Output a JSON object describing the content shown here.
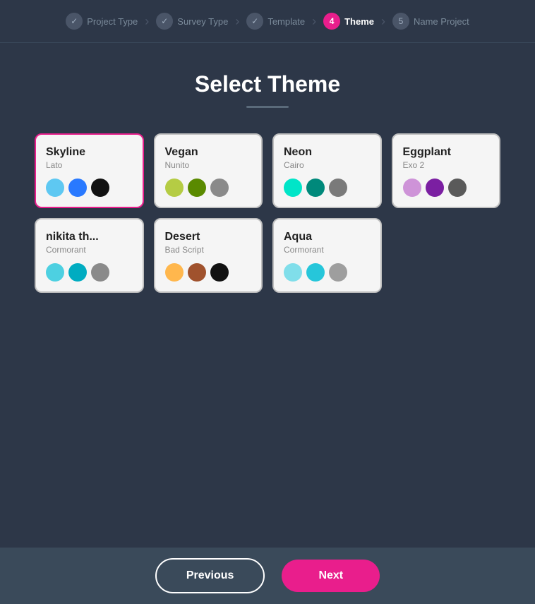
{
  "stepper": {
    "steps": [
      {
        "id": "project-type",
        "label": "Project Type",
        "state": "checked",
        "number": "✓"
      },
      {
        "id": "survey-type",
        "label": "Survey Type",
        "state": "checked",
        "number": "✓"
      },
      {
        "id": "template",
        "label": "Template",
        "state": "checked",
        "number": "✓"
      },
      {
        "id": "theme",
        "label": "Theme",
        "state": "active",
        "number": "4"
      },
      {
        "id": "name-project",
        "label": "Name Project",
        "state": "inactive",
        "number": "5"
      }
    ]
  },
  "page": {
    "title": "Select Theme",
    "themes": [
      {
        "id": "skyline",
        "name": "Skyline",
        "font": "Lato",
        "selected": true,
        "colors": [
          "#5ec8f2",
          "#2979ff",
          "#111111"
        ]
      },
      {
        "id": "vegan",
        "name": "Vegan",
        "font": "Nunito",
        "selected": false,
        "colors": [
          "#b5cc44",
          "#5a8a00",
          "#8a8a8a"
        ]
      },
      {
        "id": "neon",
        "name": "Neon",
        "font": "Cairo",
        "selected": false,
        "colors": [
          "#00e5c8",
          "#00897b",
          "#7a7a7a"
        ]
      },
      {
        "id": "eggplant",
        "name": "Eggplant",
        "font": "Exo 2",
        "selected": false,
        "colors": [
          "#ce93d8",
          "#7b1fa2",
          "#5a5a5a"
        ]
      },
      {
        "id": "nikita",
        "name": "nikita th...",
        "font": "Cormorant",
        "selected": false,
        "colors": [
          "#4dd0e1",
          "#00acc1",
          "#8a8a8a"
        ]
      },
      {
        "id": "desert",
        "name": "Desert",
        "font": "Bad Script",
        "selected": false,
        "colors": [
          "#ffb74d",
          "#a0522d",
          "#111111"
        ]
      },
      {
        "id": "aqua",
        "name": "Aqua",
        "font": "Cormorant",
        "selected": false,
        "colors": [
          "#80deea",
          "#26c6da",
          "#9e9e9e"
        ]
      }
    ]
  },
  "footer": {
    "previous_label": "Previous",
    "next_label": "Next"
  }
}
